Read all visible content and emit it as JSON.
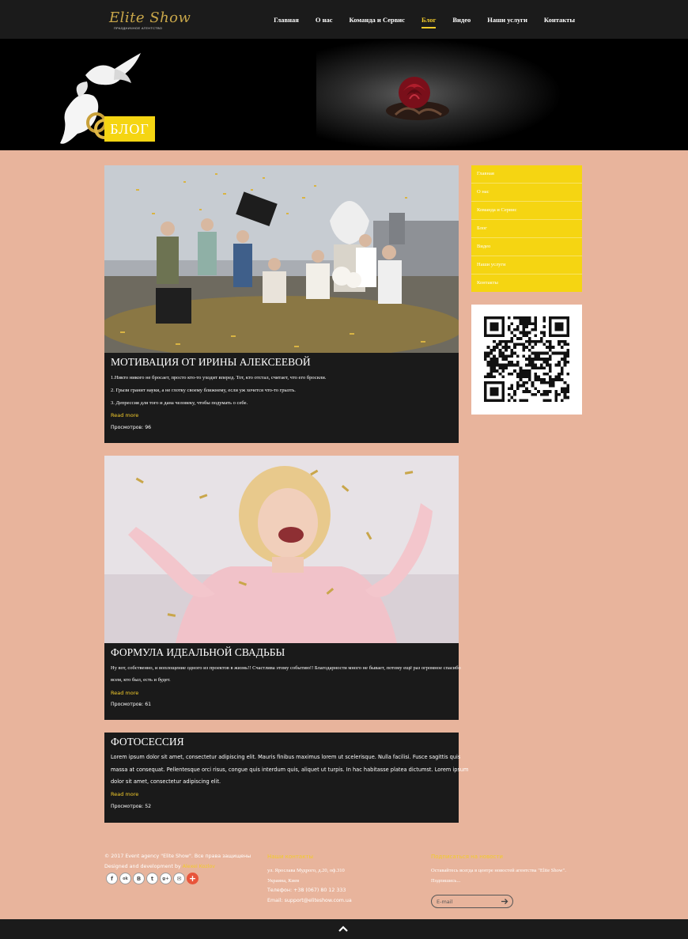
{
  "header": {
    "logo_main": "Elite Show",
    "logo_sub": "ПРАЗДНИЧНОЕ АГЕНТСТВО",
    "nav": [
      {
        "label": "Главная"
      },
      {
        "label": "О нас"
      },
      {
        "label": "Команда и Сервис"
      },
      {
        "label": "Блог",
        "active": true
      },
      {
        "label": "Видео"
      },
      {
        "label": "Наши услуги"
      },
      {
        "label": "Контакты"
      }
    ],
    "accent_color": "#f3cb2b"
  },
  "banner": {
    "title": "БЛОГ"
  },
  "posts": [
    {
      "title": "МОТИВАЦИЯ ОТ ИРИНЫ АЛЕКСЕЕВОЙ",
      "lines": [
        "1.Никто никого не бросает, просто кто-то уходит вперед. Тот, кто отстал, считает, что его бросили.",
        "2. Грызи гранит науки, а не глотку своему ближнему, если уж хочется что-то грызть.",
        "3. Депрессия для того и дана человеку, чтобы подумать о себе."
      ],
      "read_more": "Read more",
      "views": "Просмотров: 96"
    },
    {
      "title": "ФОРМУЛА ИДЕАЛЬНОЙ СВАДЬБЫ",
      "lines": [
        "Ну вот, собственно, и воплощение одного из проектов в жизнь!! Счастлива этому событию!! Благодарности много не бывает, потому ещё раз огромное спасибо",
        "всем, кто был, есть и будет."
      ],
      "read_more": "Read more",
      "views": "Просмотров: 61"
    },
    {
      "title": "ФОТОСЕССИЯ",
      "lines": [
        "Lorem ipsum dolor sit amet, consectetur adipiscing elit. Mauris finibus maximus lorem ut scelerisque. Nulla facilisi. Fusce sagittis quis",
        "massa at consequat. Pellentesque orci risus, congue quis interdum quis, aliquet ut turpis. In hac habitasse platea dictumst. Lorem ipsum",
        "dolor sit amet, consectetur adipiscing elit."
      ],
      "read_more": "Read more",
      "views": "Просмотров: 52"
    }
  ],
  "sidebar": {
    "menu": [
      {
        "label": "Главная"
      },
      {
        "label": "О нас"
      },
      {
        "label": "Команда и Сервис"
      },
      {
        "label": "Блог"
      },
      {
        "label": "Видео"
      },
      {
        "label": "Наши услуги"
      },
      {
        "label": "Контакты"
      }
    ]
  },
  "footer": {
    "copyright": "© 2017 Event agency \"Elite Show\". Все права защищены",
    "designed_by": "Designed and development by",
    "designed_by_link": "Alexei Kozlov",
    "contacts_head": "Наши контакты",
    "address_line1": "ул. Ярослава Мудрого, д.20, оф.310",
    "address_line2": "Украина, Киев",
    "phone": "Телефон:  +38 (067) 80 12 333",
    "email": "Email:  support@eliteshow.com.ua",
    "subscribe_head": "Подписаться на новости",
    "subscribe_text": "Оставайтесь всегда в центре новостей агентства \"Elite Show\".",
    "subscribe_text2": "Подпишись...",
    "email_placeholder": "E-mail",
    "social": [
      {
        "icon": "facebook-icon",
        "glyph": "f"
      },
      {
        "icon": "odnoklassniki-icon",
        "glyph": "ok"
      },
      {
        "icon": "vkontakte-icon",
        "glyph": "B"
      },
      {
        "icon": "twitter-icon",
        "glyph": "t"
      },
      {
        "icon": "google-plus-icon",
        "glyph": "g+"
      },
      {
        "icon": "mail-icon",
        "glyph": "✉"
      },
      {
        "icon": "share-plus-icon",
        "glyph": "+"
      }
    ]
  }
}
